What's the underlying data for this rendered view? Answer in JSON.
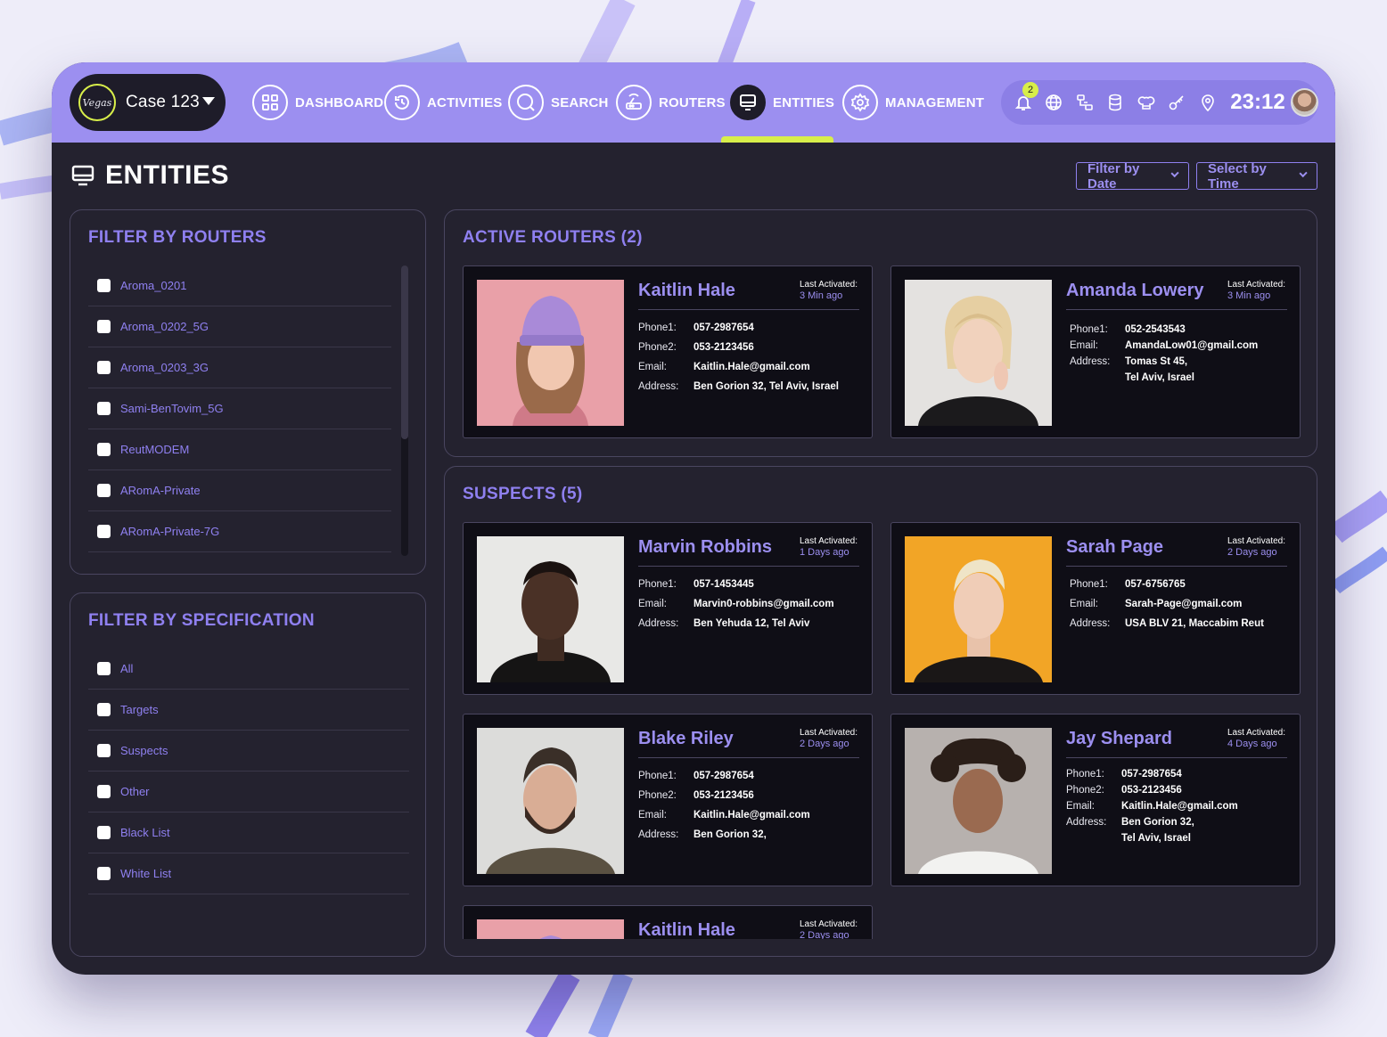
{
  "header": {
    "case_label": "Case 123",
    "logo_text": "Vegas",
    "nav": [
      {
        "id": "dashboard",
        "label": "DASHBOARD"
      },
      {
        "id": "activities",
        "label": "ACTIVITIES"
      },
      {
        "id": "search",
        "label": "SEARCH"
      },
      {
        "id": "routers",
        "label": "ROUTERS"
      },
      {
        "id": "entities",
        "label": "ENTITIES",
        "active": true
      },
      {
        "id": "management",
        "label": "MANAGEMENT"
      }
    ],
    "notification_count": "2",
    "clock": "23:12",
    "status_icons": [
      "bell-icon",
      "globe-icon",
      "network-icon",
      "database-icon",
      "chef-hat-icon",
      "key-icon",
      "location-pin-icon"
    ]
  },
  "page": {
    "title": "ENTITIES",
    "filter_date": "Filter by Date",
    "filter_time": "Select by Time"
  },
  "routers_filter": {
    "title": "FILTER BY ROUTERS",
    "items": [
      "Aroma_0201",
      "Aroma_0202_5G",
      "Aroma_0203_3G",
      "Sami-BenTovim_5G",
      "ReutMODEM",
      "ARomA-Private",
      "ARomA-Private-7G"
    ]
  },
  "spec_filter": {
    "title": "FILTER BY SPECIFICATION",
    "items": [
      "All",
      "Targets",
      "Suspects",
      "Other",
      "Black List",
      "White List"
    ]
  },
  "active_routers": {
    "title": "ACTIVE ROUTERS (2)",
    "cards": [
      {
        "name": "Kaitlin Hale",
        "la_label": "Last Activated:",
        "la_value": "3 Min ago",
        "rows": [
          {
            "k": "Phone1:",
            "v": "057-2987654"
          },
          {
            "k": "Phone2:",
            "v": "053-2123456"
          },
          {
            "k": "Email:",
            "v": "Kaitlin.Hale@gmail.com"
          },
          {
            "k": "Address:",
            "v": "Ben Gorion 32,  Tel Aviv, Israel"
          }
        ]
      },
      {
        "name": "Amanda Lowery",
        "la_label": "Last Activated:",
        "la_value": "3 Min ago",
        "rows": [
          {
            "k": "Phone1:",
            "v": "052-2543543"
          },
          {
            "k": "Email:",
            "v": "AmandaLow01@gmail.com"
          },
          {
            "k": "Address:",
            "v": "Tomas St 45,",
            "v2": "Tel Aviv, Israel"
          }
        ]
      }
    ]
  },
  "suspects": {
    "title": "SUSPECTS (5)",
    "cards": [
      {
        "name": "Marvin Robbins",
        "la_label": "Last Activated:",
        "la_value": "1 Days ago",
        "rows": [
          {
            "k": "Phone1:",
            "v": "057-1453445"
          },
          {
            "k": "Email:",
            "v": "Marvin0-robbins@gmail.com"
          },
          {
            "k": "Address:",
            "v": "Ben Yehuda 12, Tel Aviv"
          }
        ]
      },
      {
        "name": "Sarah Page",
        "la_label": "Last Activated:",
        "la_value": "2 Days ago",
        "rows": [
          {
            "k": "Phone1:",
            "v": "057-6756765"
          },
          {
            "k": "Email:",
            "v": "Sarah-Page@gmail.com"
          },
          {
            "k": "Address:",
            "v": "USA BLV 21, Maccabim Reut"
          }
        ]
      },
      {
        "name": "Blake Riley",
        "la_label": "Last Activated:",
        "la_value": "2 Days ago",
        "rows": [
          {
            "k": "Phone1:",
            "v": "057-2987654"
          },
          {
            "k": "Phone2:",
            "v": "053-2123456"
          },
          {
            "k": "Email:",
            "v": "Kaitlin.Hale@gmail.com"
          },
          {
            "k": "Address:",
            "v": "Ben Gorion 32,"
          }
        ]
      },
      {
        "name": "Jay Shepard",
        "la_label": "Last Activated:",
        "la_value": "4 Days ago",
        "rows": [
          {
            "k": "Phone1:",
            "v": "057-2987654"
          },
          {
            "k": "Phone2:",
            "v": "053-2123456"
          },
          {
            "k": "Email:",
            "v": "Kaitlin.Hale@gmail.com"
          },
          {
            "k": "Address:",
            "v": "Ben Gorion 32,",
            "v2": "Tel Aviv, Israel"
          }
        ]
      },
      {
        "name": "Kaitlin Hale",
        "la_label": "Last Activated:",
        "la_value": "2 Days ago",
        "rows": []
      }
    ]
  },
  "colors": {
    "accent": "#9c8ff0",
    "highlight": "#d8ee4a",
    "surface": "#24222f",
    "card": "#0f0e16"
  }
}
